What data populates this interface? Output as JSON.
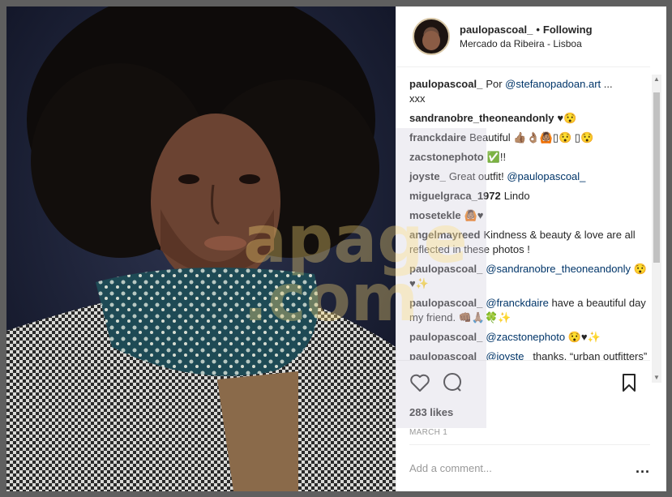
{
  "post": {
    "username": "paulopascoal_",
    "separator": "•",
    "follow_state": "Following",
    "location": "Mercado da Ribeira - Lisboa",
    "likes": "283 likes",
    "date": "MARCH 1",
    "comment_placeholder": "Add a comment...",
    "more_label": "..."
  },
  "comments": [
    {
      "user": "paulopascoal_",
      "pre": "Por ",
      "mention": "@stefanopadoan.art",
      "post": " ...\nxxx"
    },
    {
      "user": "sandranobre_theoneandonly",
      "pre": "♥😯",
      "mention": "",
      "post": ""
    },
    {
      "user": "franckdaire",
      "pre": "Beautiful 👍🏽👌🏽🙆🏽▯😯 ▯😯",
      "mention": "",
      "post": ""
    },
    {
      "user": "zacstonephoto",
      "pre": "✅!!",
      "mention": "",
      "post": ""
    },
    {
      "user": "joyste_",
      "pre": "Great outfit! ",
      "mention": "@paulopascoal_",
      "post": ""
    },
    {
      "user": "miguelgraca_1972",
      "pre": "Lindo",
      "mention": "",
      "post": ""
    },
    {
      "user": "mosetekle",
      "pre": "🙆🏽♥",
      "mention": "",
      "post": ""
    },
    {
      "user": "angelmayreed",
      "pre": "Kindness & beauty & love are all reflected in these photos !",
      "mention": "",
      "post": ""
    },
    {
      "user": "paulopascoal_",
      "pre": "",
      "mention": "@sandranobre_theoneandonly",
      "post": " 😯♥✨"
    },
    {
      "user": "paulopascoal_",
      "pre": "",
      "mention": "@franckdaire",
      "post": " have a beautiful day my friend. 👊🏾🙏🏽🍀✨"
    },
    {
      "user": "paulopascoal_",
      "pre": "",
      "mention": "@zacstonephoto",
      "post": " 😯♥✨"
    },
    {
      "user": "paulopascoal_",
      "pre": "",
      "mention": "@joyste_",
      "post": " thanks, “urban outfitters” meets “feira da ladra” meets “a"
    }
  ],
  "icons": {
    "like": "heart-icon",
    "comment": "comment-bubble-icon",
    "save": "bookmark-icon"
  },
  "watermark": "apage\n.com",
  "colors": {
    "text": "#262626",
    "mention": "#003569",
    "muted": "#999999",
    "border": "#efefef"
  }
}
